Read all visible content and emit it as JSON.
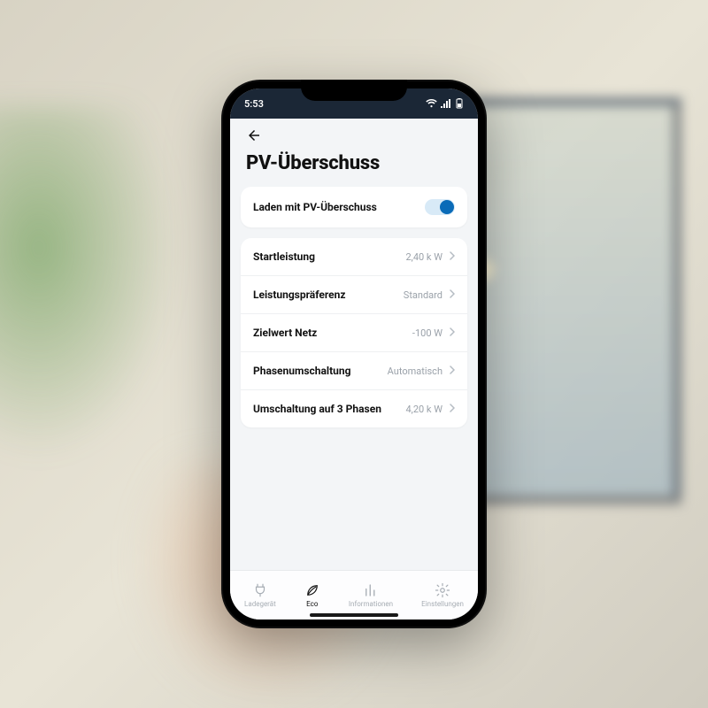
{
  "status": {
    "time": "5:53"
  },
  "header": {
    "title": "PV-Überschuss"
  },
  "toggle_card": {
    "label": "Laden mit PV-Überschuss",
    "enabled": true
  },
  "settings": [
    {
      "label": "Startleistung",
      "value": "2,40 k W"
    },
    {
      "label": "Leistungspräferenz",
      "value": "Standard"
    },
    {
      "label": "Zielwert Netz",
      "value": "-100 W"
    },
    {
      "label": "Phasenumschaltung",
      "value": "Automatisch"
    },
    {
      "label": "Umschaltung auf 3 Phasen",
      "value": "4,20 k W"
    }
  ],
  "tabs": [
    {
      "label": "Ladegerät"
    },
    {
      "label": "Eco"
    },
    {
      "label": "Informationen"
    },
    {
      "label": "Einstellungen"
    }
  ],
  "active_tab": 1
}
